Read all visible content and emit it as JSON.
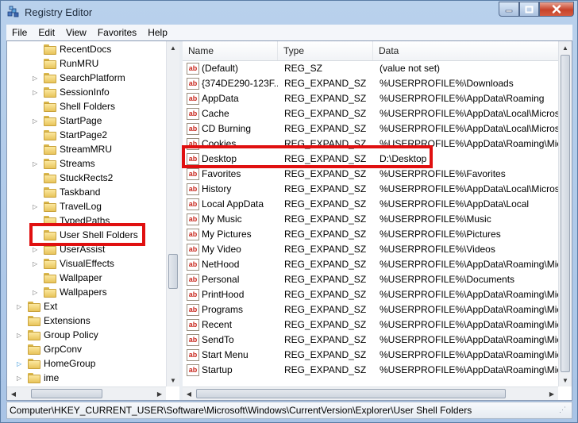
{
  "window": {
    "title": "Registry Editor"
  },
  "menu": [
    "File",
    "Edit",
    "View",
    "Favorites",
    "Help"
  ],
  "tree": {
    "items": [
      {
        "label": "RecentDocs",
        "depth": 1,
        "expander": "none"
      },
      {
        "label": "RunMRU",
        "depth": 1,
        "expander": "none"
      },
      {
        "label": "SearchPlatform",
        "depth": 1,
        "expander": "collapsed"
      },
      {
        "label": "SessionInfo",
        "depth": 1,
        "expander": "collapsed"
      },
      {
        "label": "Shell Folders",
        "depth": 1,
        "expander": "none"
      },
      {
        "label": "StartPage",
        "depth": 1,
        "expander": "collapsed"
      },
      {
        "label": "StartPage2",
        "depth": 1,
        "expander": "none"
      },
      {
        "label": "StreamMRU",
        "depth": 1,
        "expander": "none"
      },
      {
        "label": "Streams",
        "depth": 1,
        "expander": "collapsed"
      },
      {
        "label": "StuckRects2",
        "depth": 1,
        "expander": "none"
      },
      {
        "label": "Taskband",
        "depth": 1,
        "expander": "none"
      },
      {
        "label": "TravelLog",
        "depth": 1,
        "expander": "collapsed"
      },
      {
        "label": "TypedPaths",
        "depth": 1,
        "expander": "none"
      },
      {
        "label": "User Shell Folders",
        "depth": 1,
        "expander": "none",
        "selected": true
      },
      {
        "label": "UserAssist",
        "depth": 1,
        "expander": "collapsed"
      },
      {
        "label": "VisualEffects",
        "depth": 1,
        "expander": "collapsed"
      },
      {
        "label": "Wallpaper",
        "depth": 1,
        "expander": "none"
      },
      {
        "label": "Wallpapers",
        "depth": 1,
        "expander": "collapsed"
      },
      {
        "label": "Ext",
        "depth": 0,
        "expander": "collapsed"
      },
      {
        "label": "Extensions",
        "depth": 0,
        "expander": "none"
      },
      {
        "label": "Group Policy",
        "depth": 0,
        "expander": "collapsed"
      },
      {
        "label": "GrpConv",
        "depth": 0,
        "expander": "none"
      },
      {
        "label": "HomeGroup",
        "depth": 0,
        "expander": "collapsed-blue"
      },
      {
        "label": "ime",
        "depth": 0,
        "expander": "collapsed"
      }
    ]
  },
  "list": {
    "columns": [
      "Name",
      "Type",
      "Data"
    ],
    "rows": [
      {
        "name": "(Default)",
        "type": "REG_SZ",
        "data": "(value not set)"
      },
      {
        "name": "{374DE290-123F...",
        "type": "REG_EXPAND_SZ",
        "data": "%USERPROFILE%\\Downloads"
      },
      {
        "name": "AppData",
        "type": "REG_EXPAND_SZ",
        "data": "%USERPROFILE%\\AppData\\Roaming"
      },
      {
        "name": "Cache",
        "type": "REG_EXPAND_SZ",
        "data": "%USERPROFILE%\\AppData\\Local\\Microsof"
      },
      {
        "name": "CD Burning",
        "type": "REG_EXPAND_SZ",
        "data": "%USERPROFILE%\\AppData\\Local\\Microsof"
      },
      {
        "name": "Cookies",
        "type": "REG_EXPAND_SZ",
        "data": "%USERPROFILE%\\AppData\\Roaming\\Micr"
      },
      {
        "name": "Desktop",
        "type": "REG_EXPAND_SZ",
        "data": "D:\\Desktop",
        "highlighted": true
      },
      {
        "name": "Favorites",
        "type": "REG_EXPAND_SZ",
        "data": "%USERPROFILE%\\Favorites"
      },
      {
        "name": "History",
        "type": "REG_EXPAND_SZ",
        "data": "%USERPROFILE%\\AppData\\Local\\Microsof"
      },
      {
        "name": "Local AppData",
        "type": "REG_EXPAND_SZ",
        "data": "%USERPROFILE%\\AppData\\Local"
      },
      {
        "name": "My Music",
        "type": "REG_EXPAND_SZ",
        "data": "%USERPROFILE%\\Music"
      },
      {
        "name": "My Pictures",
        "type": "REG_EXPAND_SZ",
        "data": "%USERPROFILE%\\Pictures"
      },
      {
        "name": "My Video",
        "type": "REG_EXPAND_SZ",
        "data": "%USERPROFILE%\\Videos"
      },
      {
        "name": "NetHood",
        "type": "REG_EXPAND_SZ",
        "data": "%USERPROFILE%\\AppData\\Roaming\\Micr"
      },
      {
        "name": "Personal",
        "type": "REG_EXPAND_SZ",
        "data": "%USERPROFILE%\\Documents"
      },
      {
        "name": "PrintHood",
        "type": "REG_EXPAND_SZ",
        "data": "%USERPROFILE%\\AppData\\Roaming\\Micr"
      },
      {
        "name": "Programs",
        "type": "REG_EXPAND_SZ",
        "data": "%USERPROFILE%\\AppData\\Roaming\\Micr"
      },
      {
        "name": "Recent",
        "type": "REG_EXPAND_SZ",
        "data": "%USERPROFILE%\\AppData\\Roaming\\Micr"
      },
      {
        "name": "SendTo",
        "type": "REG_EXPAND_SZ",
        "data": "%USERPROFILE%\\AppData\\Roaming\\Micr"
      },
      {
        "name": "Start Menu",
        "type": "REG_EXPAND_SZ",
        "data": "%USERPROFILE%\\AppData\\Roaming\\Micr"
      },
      {
        "name": "Startup",
        "type": "REG_EXPAND_SZ",
        "data": "%USERPROFILE%\\AppData\\Roaming\\Micr"
      }
    ],
    "value_icon_text": "ab"
  },
  "status": {
    "path": "Computer\\HKEY_CURRENT_USER\\Software\\Microsoft\\Windows\\CurrentVersion\\Explorer\\User Shell Folders"
  },
  "icons": {
    "app": "registry-editor-icon",
    "minimize": "minimize-icon",
    "maximize": "maximize-icon",
    "close": "close-icon",
    "folder": "folder-icon",
    "value": "string-value-icon"
  },
  "colors": {
    "highlight": "#e01010",
    "close": "#c7432a"
  }
}
